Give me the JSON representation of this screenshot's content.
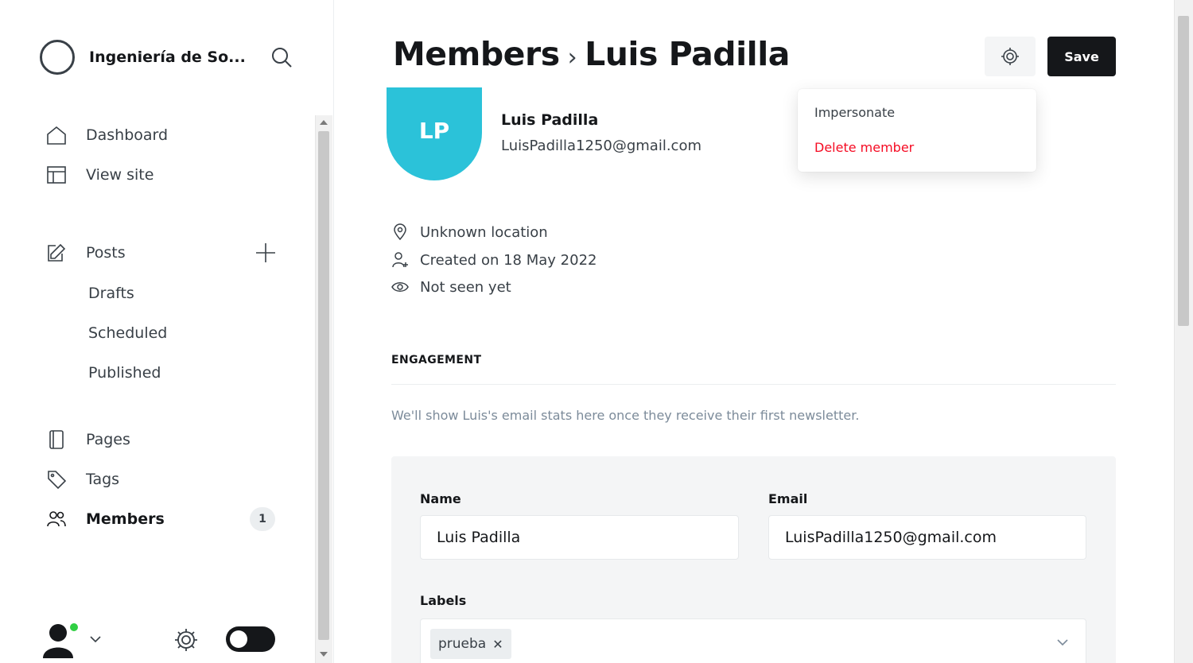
{
  "sidebar": {
    "site_name": "Ingeniería de So...",
    "nav": {
      "dashboard": "Dashboard",
      "view_site": "View site",
      "posts": "Posts",
      "drafts": "Drafts",
      "scheduled": "Scheduled",
      "published": "Published",
      "pages": "Pages",
      "tags": "Tags",
      "members": "Members",
      "members_count": "1"
    }
  },
  "header": {
    "breadcrumb_parent": "Members",
    "breadcrumb_separator": "›",
    "breadcrumb_current": "Luis Padilla",
    "save_label": "Save"
  },
  "actions_menu": {
    "impersonate": "Impersonate",
    "delete": "Delete member"
  },
  "member": {
    "initials": "LP",
    "name": "Luis Padilla",
    "email": "LuisPadilla1250@gmail.com",
    "location": "Unknown location",
    "created": "Created on 18 May 2022",
    "seen": "Not seen yet"
  },
  "engagement": {
    "title": "ENGAGEMENT",
    "note": "We'll show Luis's email stats here once they receive their first newsletter."
  },
  "form": {
    "name_label": "Name",
    "name_value": "Luis Padilla",
    "email_label": "Email",
    "email_value": "LuisPadilla1250@gmail.com",
    "labels_label": "Labels",
    "labels": [
      "prueba"
    ]
  },
  "colors": {
    "avatar": "#2bc2d9",
    "danger": "#f50b23",
    "online": "#30cf43",
    "primary_button": "#15171a"
  }
}
